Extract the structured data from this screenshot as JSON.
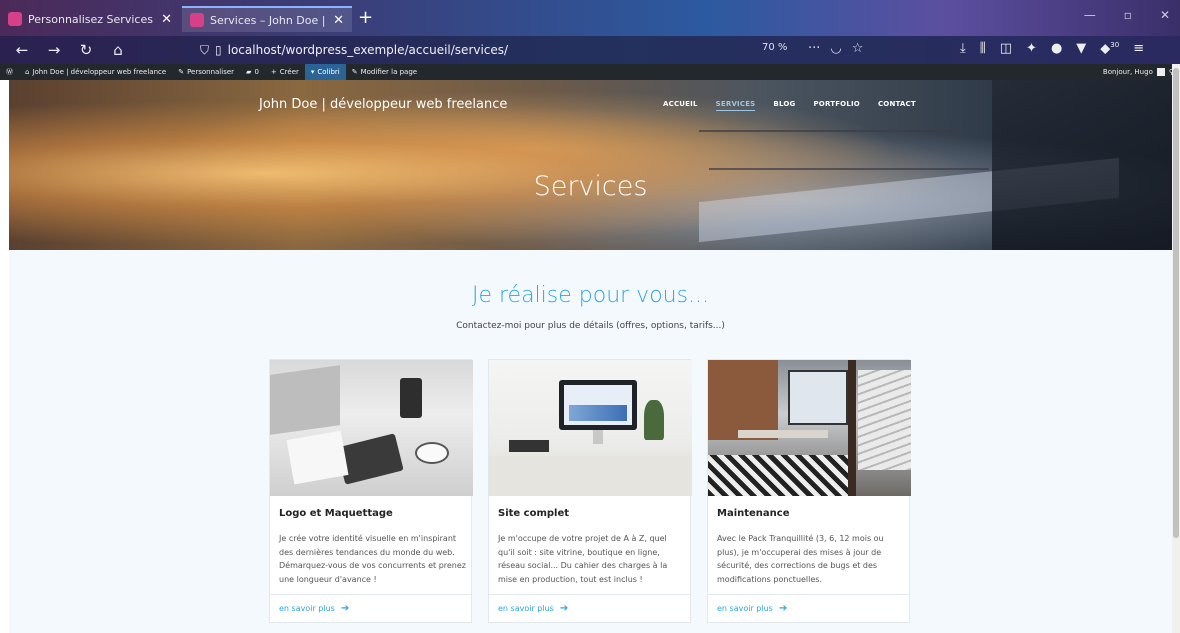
{
  "browser": {
    "tabs": [
      {
        "title": "Personnalisez Services – John D"
      },
      {
        "title": "Services – John Doe | développ"
      }
    ],
    "url": "localhost/wordpress_exemple/accueil/services/",
    "zoom": "70 %",
    "url_actions": "···",
    "badge_count": "30"
  },
  "adminbar": {
    "site": "John Doe | développeur web freelance",
    "customize": "Personnaliser",
    "comments": "0",
    "new": "Créer",
    "colibri": "Colibri",
    "edit": "Modifier la page",
    "greeting": "Bonjour, Hugo"
  },
  "hero": {
    "site_title": "John Doe | développeur web freelance",
    "menu": [
      "ACCUEIL",
      "SERVICES",
      "BLOG",
      "PORTFOLIO",
      "CONTACT"
    ],
    "page_title": "Services"
  },
  "main": {
    "headline": "Je réalise pour vous...",
    "subline": "Contactez-moi pour plus de détails (offres, options, tarifs...)",
    "cards": [
      {
        "title": "Logo et Maquettage",
        "text": "Je crée votre identité visuelle en m'inspirant des dernières tendances du monde du web. Démarquez-vous de vos concurrents et prenez une longueur d'avance !",
        "link": "en savoir plus"
      },
      {
        "title": "Site complet",
        "text": "Je m'occupe de votre projet de A à Z, quel qu'il soit : site vitrine, boutique en ligne, réseau social... Du cahier des charges à la mise en production, tout est inclus !",
        "link": "en savoir plus"
      },
      {
        "title": "Maintenance",
        "text": "Avec le Pack Tranquillité (3, 6, 12 mois ou plus), je m'occuperai des mises à jour de sécurité, des corrections de bugs et des modifications ponctuelles.",
        "link": "en savoir plus"
      }
    ]
  },
  "colors": {
    "accent": "#2ca7de",
    "adminbar": "#23282d",
    "content_bg": "#f4f9fd"
  }
}
